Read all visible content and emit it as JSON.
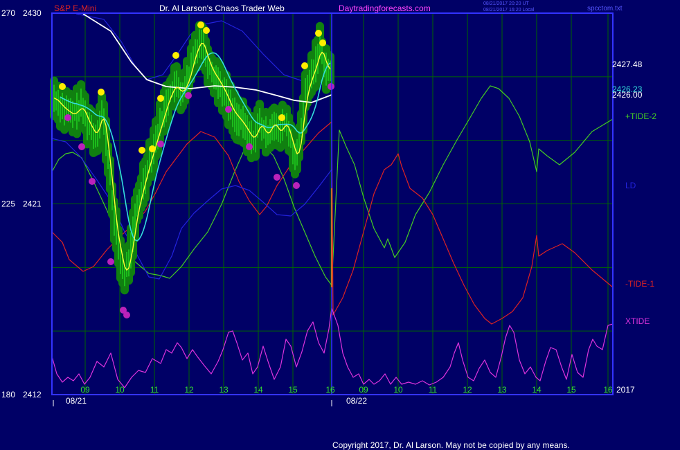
{
  "header": {
    "symbol": "S&P E-Mini",
    "title": "Dr. Al Larson's Chaos Trader Web",
    "site": "Daytradingforecasts.com",
    "stamp_line1": "08/21/2017 20:20 UT",
    "stamp_line2": "08/21/2017 16:20 Local",
    "file": "spcctom.txt"
  },
  "footer": {
    "copyright": "Copyright 2017, Dr. Al Larson. May not be copied by any means."
  },
  "chart_data": {
    "type": "line",
    "price_axis": {
      "min": 2412,
      "max": 2430,
      "ticks": [
        2430,
        2421,
        2412
      ]
    },
    "angle_axis": {
      "ticks": [
        270,
        225,
        180
      ]
    },
    "price_labels": [
      "2427.48",
      "2426.23",
      "2426.00"
    ],
    "x_axis": {
      "hour_labels_day1": [
        "09",
        "10",
        "11",
        "12",
        "13",
        "14",
        "15",
        "16"
      ],
      "hour_labels_day2": [
        "09",
        "10",
        "11",
        "12",
        "13",
        "14",
        "15",
        "16"
      ],
      "date_labels": [
        "08/21",
        "08/22"
      ],
      "year_label": "2017"
    },
    "series": [
      {
        "name": "+TIDE-2",
        "color": "#44cc22"
      },
      {
        "name": "LD",
        "color": "#2222dd"
      },
      {
        "name": "-TIDE-1",
        "color": "#dd2222"
      },
      {
        "name": "XTIDE",
        "color": "#dd33dd"
      }
    ],
    "price_overlays": {
      "moving_average_colors": [
        "#ffffff",
        "#33dddd",
        "#ffff33",
        "#2222dd"
      ]
    },
    "colors": {
      "background": "#000066",
      "plot_border": "#3333ff",
      "grid": "#006600",
      "bars": "#22dd22",
      "halo": "#108010",
      "high_dot": "#ffee00",
      "low_dot": "#bb22bb",
      "cursor": "#ff8800"
    }
  }
}
